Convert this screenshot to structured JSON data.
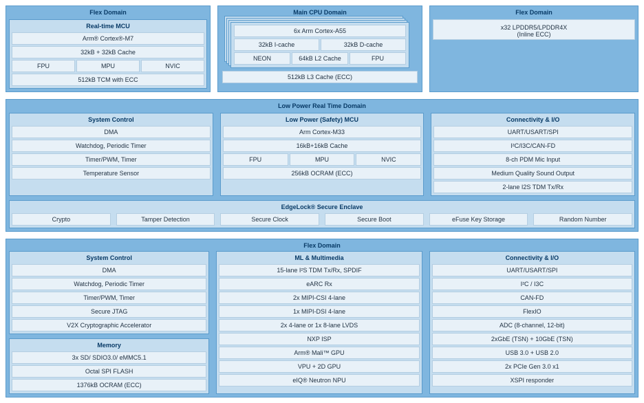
{
  "top": {
    "flex1": {
      "title": "Flex Domain",
      "mcu": {
        "title": "Real-time MCU",
        "core": "Arm® Cortex®-M7",
        "cache": "32kB + 32kB Cache",
        "fpu": "FPU",
        "mpu": "MPU",
        "nvic": "NVIC",
        "tcm": "512kB TCM with ECC"
      }
    },
    "cpu": {
      "title": "Main CPU Domain",
      "core": "6x Arm Cortex-A55",
      "icache": "32kB I-cache",
      "dcache": "32kB D-cache",
      "neon": "NEON",
      "l2": "64kB L2 Cache",
      "fpu": "FPU",
      "l3": "512kB L3 Cache (ECC)"
    },
    "flex2": {
      "title": "Flex Domain",
      "mem": "x32 LPDDR5/LPDDR4X",
      "ecc": "(Inline ECC)"
    }
  },
  "lp": {
    "title": "Low Power Real Time Domain",
    "sysctl": {
      "title": "System Control",
      "items": [
        "DMA",
        "Watchdog, Periodic Timer",
        "Timer/PWM, Timer",
        "Temperature Sensor"
      ]
    },
    "mcu": {
      "title": "Low Power (Safety) MCU",
      "core": "Arm Cortex-M33",
      "cache": "16kB+16kB Cache",
      "fpu": "FPU",
      "mpu": "MPU",
      "nvic": "NVIC",
      "ocram": "256kB OCRAM (ECC)"
    },
    "conn": {
      "title": "Connectivity & I/O",
      "items": [
        "UART/USART/SPI",
        "I²C/I3C/CAN-FD",
        "8-ch PDM Mic Input",
        "Medium Quality Sound Output",
        "2-lane I2S TDM Tx/Rx"
      ]
    },
    "edgelock": {
      "title": "EdgeLock® Secure Enclave",
      "items": [
        "Crypto",
        "Tamper Detection",
        "Secure Clock",
        "Secure Boot",
        "eFuse Key Storage",
        "Random Number"
      ]
    }
  },
  "fb": {
    "title": "Flex Domain",
    "sysctl": {
      "title": "System Control",
      "items": [
        "DMA",
        "Watchdog, Periodic Timer",
        "Timer/PWM, Timer",
        "Secure JTAG",
        "V2X Cryptographic Accelerator"
      ]
    },
    "memory": {
      "title": "Memory",
      "items": [
        "3x SD/ SDIO3.0/ eMMC5.1",
        "Octal SPI FLASH",
        "1376kB OCRAM (ECC)"
      ]
    },
    "ml": {
      "title": "ML & Multimedia",
      "items": [
        "15-lane I²S TDM Tx/Rx, SPDIF",
        "eARC Rx",
        "2x MIPI-CSI 4-lane",
        "1x MIPI-DSI 4-lane",
        "2x 4-lane or 1x 8-lane LVDS",
        "NXP ISP",
        "Arm® Mali™ GPU",
        "VPU + 2D GPU",
        "eIQ® Neutron NPU"
      ]
    },
    "conn": {
      "title": "Connectivity & I/O",
      "items": [
        "UART/USART/SPI",
        "I²C / I3C",
        "CAN-FD",
        "FlexIO",
        "ADC (8-channel, 12-bit)",
        "2xGbE (TSN) + 10GbE (TSN)",
        "USB 3.0 + USB 2.0",
        "2x PCIe Gen 3.0 x1",
        "XSPI responder"
      ]
    }
  }
}
